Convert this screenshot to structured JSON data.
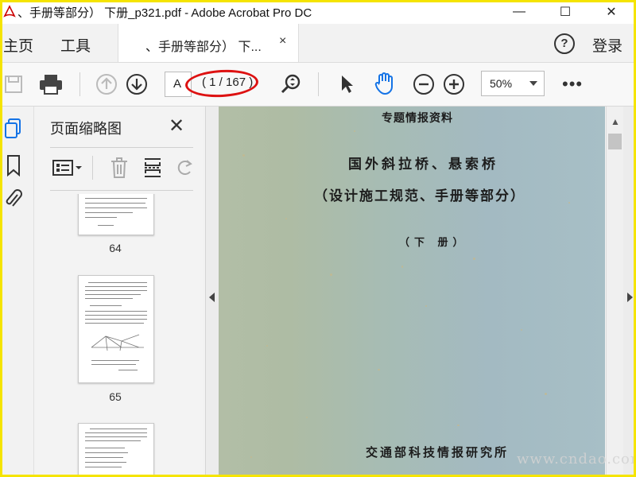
{
  "window": {
    "title": "、手册等部分） 下册_p321.pdf - Adobe Acrobat Pro DC",
    "minimize_glyph": "—",
    "maximize_glyph": "☐",
    "close_glyph": "✕"
  },
  "menu": {
    "home": "主页",
    "tools": "工具",
    "doc_tab": "、手册等部分） 下...",
    "tab_close": "×",
    "help": "?",
    "login": "登录"
  },
  "toolbar": {
    "page_input": "A",
    "page_count": "( 1 / 167 )",
    "zoom": "50%",
    "more": "•••",
    "icons": [
      "save-icon",
      "print-icon",
      "page-up-icon",
      "page-down-icon",
      "zoom-search-icon",
      "select-arrow-icon",
      "hand-tool-icon",
      "zoom-out-icon",
      "zoom-in-icon"
    ]
  },
  "panel": {
    "title": "页面缩略图",
    "close": "✕",
    "thumbnails": [
      {
        "label": "64"
      },
      {
        "label": "65"
      },
      {
        "label": ""
      }
    ]
  },
  "document": {
    "header": "专题情报资料",
    "title": "国外斜拉桥、悬索桥",
    "subtitle": "（设计施工规范、手册等部分）",
    "volume": "（下 册）",
    "publisher": "交通部科技情报研究所"
  },
  "watermark": "www.cndao.com",
  "colors": {
    "annotation": "#d11111",
    "frame": "#f5e400",
    "hand_tool": "#1473e6"
  }
}
